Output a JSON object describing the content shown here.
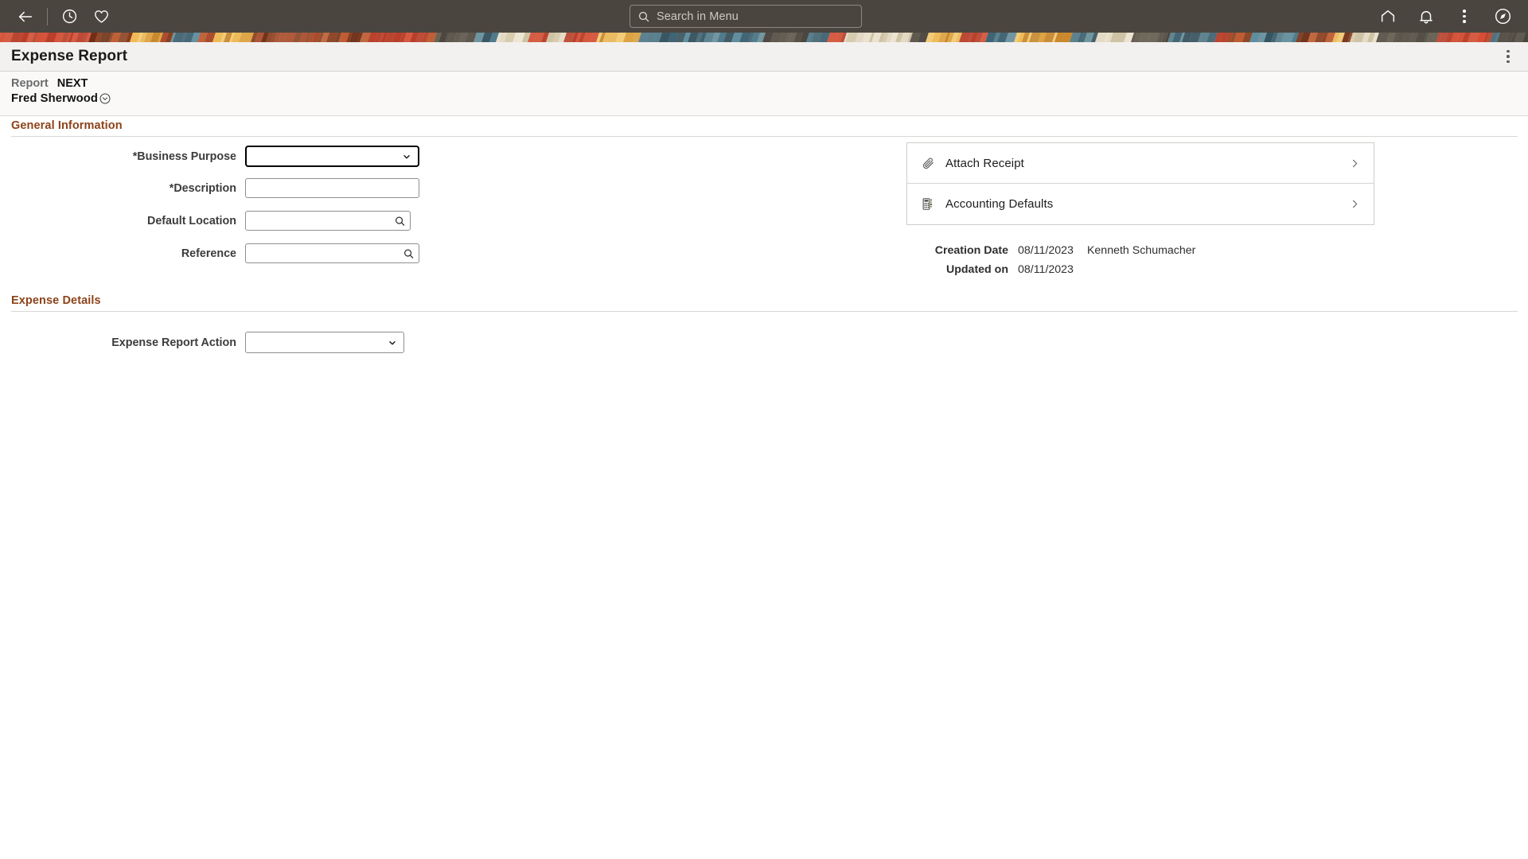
{
  "topbar": {
    "back_icon": "back-arrow-icon",
    "recent_icon": "clock-icon",
    "favorites_icon": "heart-icon",
    "home_icon": "home-icon",
    "notifications_icon": "bell-icon",
    "actions_icon": "kebab-menu-icon",
    "navbar_icon": "compass-icon",
    "search": {
      "icon": "search-icon",
      "placeholder": "Search in Menu"
    },
    "background_color": "#4a463f"
  },
  "title_bar": {
    "title": "Expense Report",
    "menu_icon": "kebab-menu-icon"
  },
  "sub_header": {
    "report_label": "Report",
    "report_value": "NEXT",
    "employee_name": "Fred Sherwood",
    "employee_dropdown_icon": "chevron-down-circle-icon"
  },
  "sections": {
    "general": {
      "heading": "General Information",
      "heading_color": "#8c431a",
      "fields": [
        {
          "label": "*Business Purpose",
          "type": "select",
          "value": "",
          "focused": true
        },
        {
          "label": "*Description",
          "type": "text",
          "value": ""
        },
        {
          "label": "Default Location",
          "type": "lookup",
          "value": "",
          "lookup_icon": "search-icon"
        },
        {
          "label": "Reference",
          "type": "lookup",
          "value": "",
          "lookup_icon": "search-icon"
        }
      ]
    },
    "expense_details": {
      "heading": "Expense Details",
      "heading_color": "#8c431a",
      "fields": [
        {
          "label": "Expense Report Action",
          "type": "select",
          "value": "",
          "focused": false
        }
      ]
    }
  },
  "right_panel": {
    "links": [
      {
        "label": "Attach Receipt",
        "icon": "paperclip-icon",
        "chevron": "chevron-right-icon"
      },
      {
        "label": "Accounting Defaults",
        "icon": "accounting-calculator-icon",
        "chevron": "chevron-right-icon"
      }
    ]
  },
  "meta": {
    "creation_label": "Creation Date",
    "creation_date": "08/11/2023",
    "creation_user": "Kenneth Schumacher",
    "updated_label": "Updated on",
    "updated_date": "08/11/2023"
  }
}
